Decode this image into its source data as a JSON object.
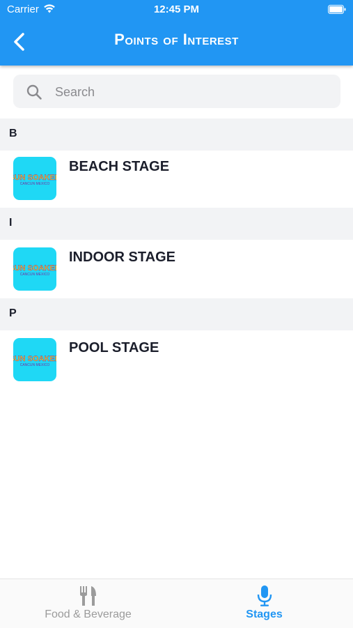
{
  "status_bar": {
    "carrier": "Carrier",
    "time": "12:45 PM"
  },
  "nav": {
    "title": "Points of Interest",
    "back_icon": "chevron-left-icon"
  },
  "search": {
    "placeholder": "Search",
    "value": ""
  },
  "sections": [
    {
      "letter": "B",
      "items": [
        {
          "label": "BEACH STAGE",
          "thumb_text": "SUN SOAKED",
          "thumb_subtext": "CANCUN MEXICO"
        }
      ]
    },
    {
      "letter": "I",
      "items": [
        {
          "label": "INDOOR STAGE",
          "thumb_text": "SUN SOAKED",
          "thumb_subtext": "CANCUN MEXICO"
        }
      ]
    },
    {
      "letter": "P",
      "items": [
        {
          "label": "POOL STAGE",
          "thumb_text": "SUN SOAKED",
          "thumb_subtext": "CANCUN MEXICO"
        }
      ]
    }
  ],
  "tabs": [
    {
      "label": "Food & Beverage",
      "icon": "fork-knife-icon",
      "active": false
    },
    {
      "label": "Stages",
      "icon": "microphone-icon",
      "active": true
    }
  ],
  "colors": {
    "header": "#2196f3",
    "active_tab": "#2196f3",
    "inactive_tab": "#9b9b9b",
    "thumb_bg": "#1fd8f5",
    "thumb_text": "#f4d21f",
    "thumb_subtext": "#7a2fa0"
  }
}
